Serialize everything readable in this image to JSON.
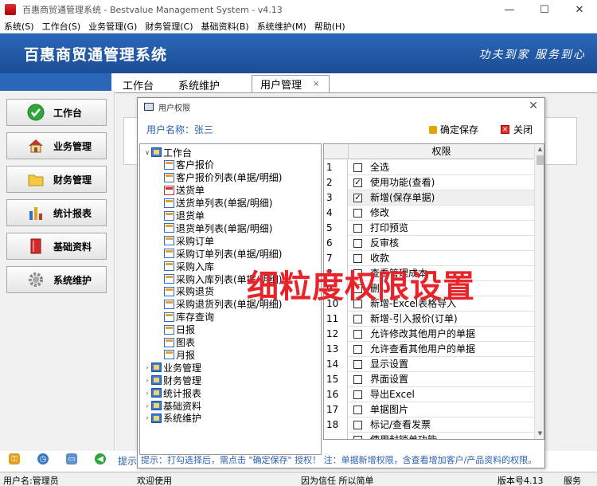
{
  "window": {
    "title": "百惠商贸通管理系统 - Bestvalue Management System - v4.13",
    "controls": {
      "minimize": "—",
      "maximize": "☐",
      "close": "✕"
    }
  },
  "menu": [
    "系统(S)",
    "工作台(S)",
    "业务管理(G)",
    "财务管理(C)",
    "基础资料(B)",
    "系统维护(M)",
    "帮助(H)"
  ],
  "banner": {
    "title": "百惠商贸通管理系统",
    "slogan": "功夫到家 服务到心"
  },
  "sidebar": [
    {
      "label": "工作台",
      "icon": "check-circle-icon"
    },
    {
      "label": "业务管理",
      "icon": "house-icon"
    },
    {
      "label": "财务管理",
      "icon": "folder-icon"
    },
    {
      "label": "统计报表",
      "icon": "bar-chart-icon"
    },
    {
      "label": "基础资料",
      "icon": "book-icon"
    },
    {
      "label": "系统维护",
      "icon": "gear-icon"
    }
  ],
  "tabs": [
    {
      "label": "工作台",
      "active": false
    },
    {
      "label": "系统维护",
      "active": false
    },
    {
      "label": "用户管理",
      "active": true,
      "close": "×"
    }
  ],
  "content_hint": "提示",
  "dialog": {
    "title": "用户权限",
    "close": "✕",
    "user_label": "用户名称：张三",
    "save": "确定保存",
    "close_btn": "关闭",
    "tree": [
      {
        "label": "工作台",
        "level": 0,
        "expanded": true,
        "type": "folder"
      },
      {
        "label": "客户报价",
        "level": 1,
        "type": "page"
      },
      {
        "label": "客户报价列表(单据/明细)",
        "level": 1,
        "type": "page"
      },
      {
        "label": "送货单",
        "level": 1,
        "type": "selected"
      },
      {
        "label": "送货单列表(单据/明细)",
        "level": 1,
        "type": "page"
      },
      {
        "label": "退货单",
        "level": 1,
        "type": "page"
      },
      {
        "label": "退货单列表(单据/明细)",
        "level": 1,
        "type": "page"
      },
      {
        "label": "采购订单",
        "level": 1,
        "type": "page"
      },
      {
        "label": "采购订单列表(单据/明细)",
        "level": 1,
        "type": "page"
      },
      {
        "label": "采购入库",
        "level": 1,
        "type": "page"
      },
      {
        "label": "采购入库列表(单据/明细)",
        "level": 1,
        "type": "page"
      },
      {
        "label": "采购退货",
        "level": 1,
        "type": "page"
      },
      {
        "label": "采购退货列表(单据/明细)",
        "level": 1,
        "type": "page"
      },
      {
        "label": "库存查询",
        "level": 1,
        "type": "page"
      },
      {
        "label": "日报",
        "level": 1,
        "type": "page"
      },
      {
        "label": "图表",
        "level": 1,
        "type": "page"
      },
      {
        "label": "月报",
        "level": 1,
        "type": "page"
      },
      {
        "label": "业务管理",
        "level": 0,
        "expanded": false,
        "type": "folder"
      },
      {
        "label": "财务管理",
        "level": 0,
        "expanded": false,
        "type": "folder"
      },
      {
        "label": "统计报表",
        "level": 0,
        "expanded": false,
        "type": "folder"
      },
      {
        "label": "基础资料",
        "level": 0,
        "expanded": false,
        "type": "folder"
      },
      {
        "label": "系统维护",
        "level": 0,
        "expanded": false,
        "type": "folder"
      }
    ],
    "grid": {
      "header": "权限",
      "rows": [
        {
          "n": "1",
          "label": "全选",
          "checked": false
        },
        {
          "n": "2",
          "label": "使用功能(查看)",
          "checked": true
        },
        {
          "n": "3",
          "label": "新增(保存单据)",
          "checked": true
        },
        {
          "n": "4",
          "label": "修改",
          "checked": false
        },
        {
          "n": "5",
          "label": "打印预览",
          "checked": false
        },
        {
          "n": "6",
          "label": "反审核",
          "checked": false
        },
        {
          "n": "7",
          "label": "收款",
          "checked": false
        },
        {
          "n": "8",
          "label": "查看管理成本",
          "checked": false
        },
        {
          "n": "9",
          "label": "删",
          "checked": false
        },
        {
          "n": "10",
          "label": "新增-Excel表格导入",
          "checked": false
        },
        {
          "n": "11",
          "label": "新增-引入报价(订单)",
          "checked": false
        },
        {
          "n": "12",
          "label": "允许修改其他用户的单据",
          "checked": false
        },
        {
          "n": "13",
          "label": "允许查看其他用户的单据",
          "checked": false
        },
        {
          "n": "14",
          "label": "显示设置",
          "checked": false
        },
        {
          "n": "15",
          "label": "界面设置",
          "checked": false
        },
        {
          "n": "16",
          "label": "导出Excel",
          "checked": false
        },
        {
          "n": "17",
          "label": "单据图片",
          "checked": false
        },
        {
          "n": "18",
          "label": "标记/查看发票",
          "checked": false
        },
        {
          "n": "",
          "label": "使用封锁单功能",
          "checked": false
        }
      ]
    },
    "hint": "提示：打勾选择后，需点击 \"确定保存\" 授权！ 注：单据新增权限，含查看增加客户/产品资料的权限。"
  },
  "overlay_text": "细粒度权限设置",
  "status": {
    "user": "用户名:管理员",
    "welcome": "欢迎使用",
    "motto": "因为信任 所以简单",
    "version": "版本号4.13",
    "service": "服务"
  },
  "colors": {
    "banner": "#1f58a6",
    "accent_text": "#2a60b0",
    "overlay": "#e8232a"
  }
}
